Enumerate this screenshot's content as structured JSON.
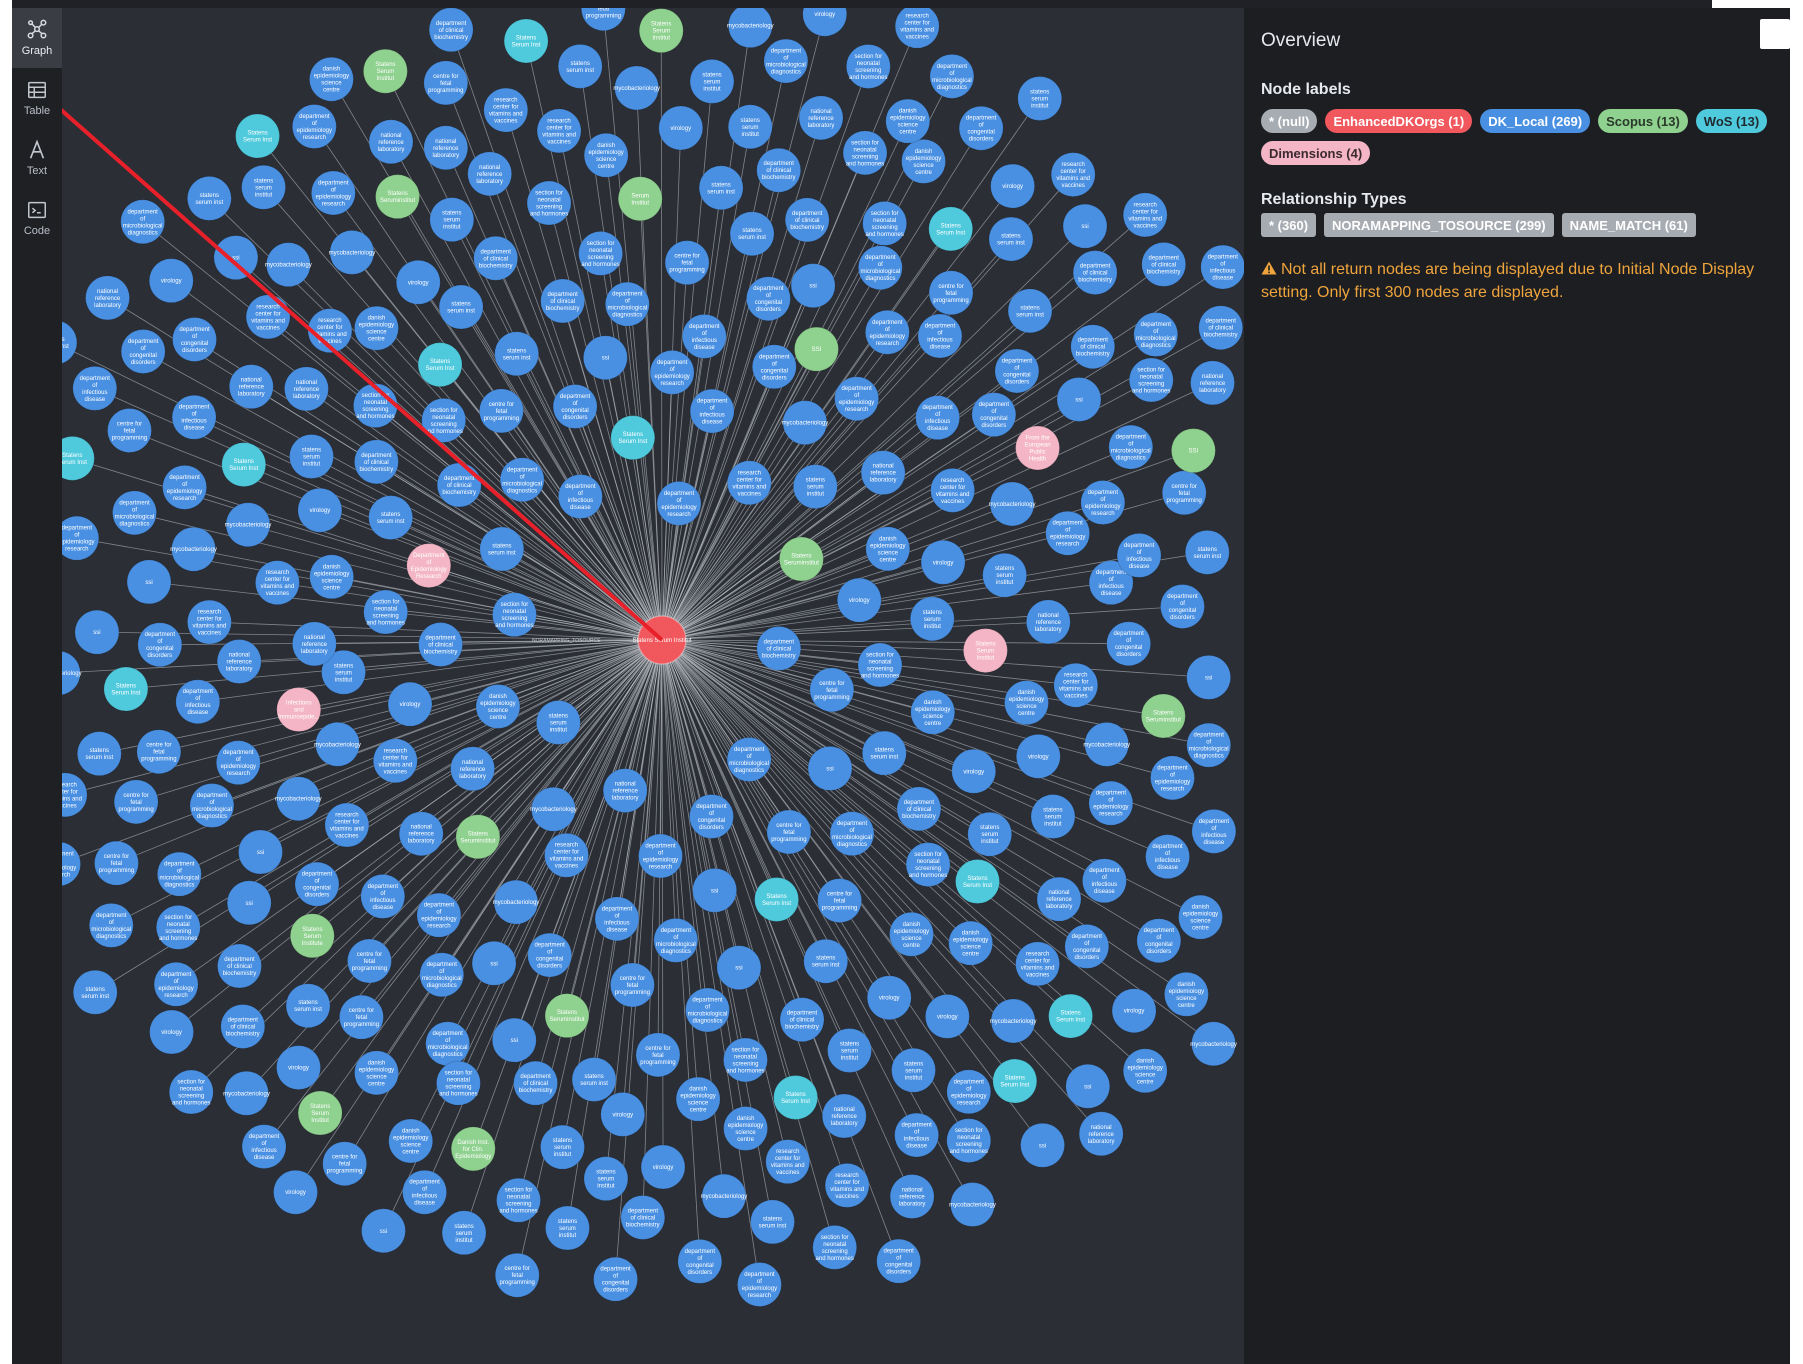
{
  "sidebar": {
    "items": [
      {
        "label": "Graph",
        "icon": "graph-icon",
        "active": true
      },
      {
        "label": "Table",
        "icon": "table-icon",
        "active": false
      },
      {
        "label": "Text",
        "icon": "text-icon",
        "active": false
      },
      {
        "label": "Code",
        "icon": "code-icon",
        "active": false
      }
    ]
  },
  "overview": {
    "title": "Overview",
    "node_labels_title": "Node labels",
    "node_labels": [
      {
        "label": "* (null)",
        "bg": "#a7abb2",
        "fg": "#ffffff"
      },
      {
        "label": "EnhancedDKOrgs (1)",
        "bg": "#f0585d",
        "fg": "#ffffff"
      },
      {
        "label": "DK_Local (269)",
        "bg": "#4a90e2",
        "fg": "#ffffff"
      },
      {
        "label": "Scopus (13)",
        "bg": "#8fd18f",
        "fg": "#2a3a2a"
      },
      {
        "label": "WoS (13)",
        "bg": "#4fc9dc",
        "fg": "#1f2a30"
      },
      {
        "label": "Dimensions (4)",
        "bg": "#f4b6c6",
        "fg": "#3a2a30"
      }
    ],
    "relationship_types_title": "Relationship Types",
    "relationship_types": [
      {
        "label": "* (360)"
      },
      {
        "label": "NORAMAPPING_TOSOURCE (299)"
      },
      {
        "label": "NAME_MATCH (61)"
      }
    ],
    "warning": "Not all return nodes are being displayed due to Initial Node Display setting. Only first 300 nodes are displayed."
  },
  "graph": {
    "center_node": {
      "label": "Statens Serum Institut",
      "color": "#f0585d"
    },
    "colors": {
      "dk_local": "#4a90e2",
      "scopus": "#8fd18f",
      "wos": "#4fc9dc",
      "dimensions": "#f4b6c6",
      "edge": "#c9cdd4",
      "annotation": "#e8202a"
    },
    "edge_labels": [
      "NORAMAPPING_TOSOURCE",
      "NAME_MATCH"
    ],
    "scopus_nodes": [
      "Statens Seruminstitut",
      "Statens Seruminstitut",
      "SSI",
      "Statens Seruminstitut",
      "Serum Institut",
      "Statens Serum Institute",
      "Statens Seruminstitut",
      "Statens Seruminstitut",
      "Danish Inst. for Clin. Epidemiology",
      "SSI",
      "Statens Serum Institut",
      "Statens Serum Institut",
      "Statens Serum Institut"
    ],
    "wos_nodes": [
      "Statens Serum Inst",
      "Statens Serum Inst",
      "Statens Serum Inst",
      "Statens Serum Inst",
      "Statens Serum Inst",
      "Statens Serum Inst",
      "Statens Serum Inst",
      "Statens Serum Inst",
      "Statens Serum Inst",
      "Statens Serum Inst",
      "Statens Serum Inst",
      "Statens Serum Inst",
      "Statens Serum Inst"
    ],
    "dimensions_nodes": [
      "Department of Epidemiology Research",
      "Statens Serum Institut",
      "Infections and Immunoepide...",
      "From the European Public Health England, London, U"
    ],
    "dk_local_samples": [
      "department of clinical biochemistry",
      "statens serum institut",
      "department of epidemiology research",
      "department of microbiological diagnostics and virology",
      "section for neonatal screening and hormones",
      "national reference laboratory",
      "department of infectious disease epidemiology",
      "centre for fetal programming",
      "danish epidemiology science centre",
      "research center for vitamins and vaccines",
      "department of congenital disorders",
      "statens serum inst",
      "virology",
      "mycobacteriology",
      "ssi"
    ]
  }
}
